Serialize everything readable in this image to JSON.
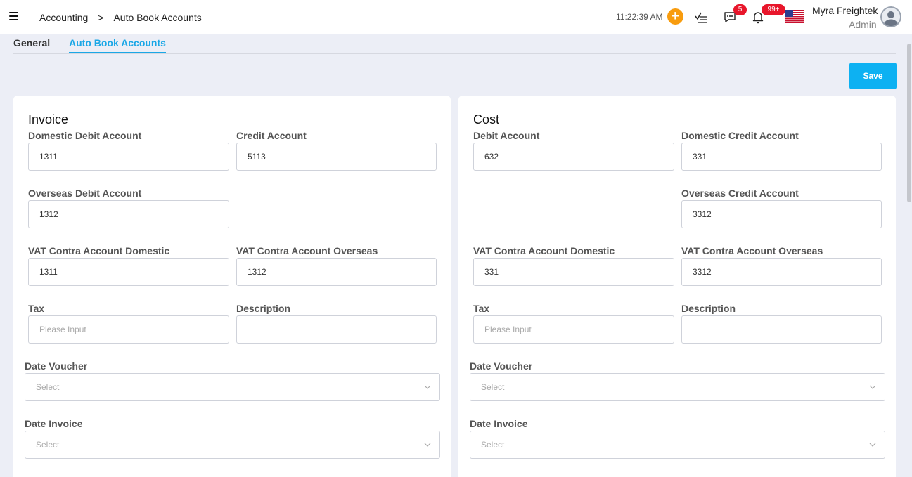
{
  "header": {
    "breadcrumb": [
      "Accounting",
      ">",
      "Auto Book Accounts"
    ],
    "clock": "11:22:39 AM",
    "add_label": "+",
    "chat_badge": "5",
    "bell_badge": "99+",
    "user_name": "Myra Freightek",
    "user_role": "Admin",
    "icons": [
      "menu-icon",
      "plus-icon",
      "checklist-icon",
      "chat-icon",
      "bell-icon",
      "us-flag-icon",
      "avatar"
    ]
  },
  "tabs": [
    {
      "label": "General",
      "active": false
    },
    {
      "label": "Auto Book Accounts",
      "active": true
    }
  ],
  "save_label": "Save",
  "invoice": {
    "title": "Invoice",
    "domestic_debit": {
      "label": "Domestic Debit Account",
      "value": "1311"
    },
    "credit": {
      "label": "Credit Account",
      "value": "5113"
    },
    "overseas_debit": {
      "label": "Overseas Debit Account",
      "value": "1312"
    },
    "vat_domestic": {
      "label": "VAT Contra Account Domestic",
      "value": "1311"
    },
    "vat_overseas": {
      "label": "VAT Contra Account Overseas",
      "value": "1312"
    },
    "tax": {
      "label": "Tax",
      "placeholder": "Please Input"
    },
    "description": {
      "label": "Description",
      "value": ""
    },
    "date_voucher": {
      "label": "Date Voucher",
      "placeholder": "Select"
    },
    "date_invoice": {
      "label": "Date Invoice",
      "placeholder": "Select"
    }
  },
  "cost": {
    "title": "Cost",
    "debit": {
      "label": "Debit Account",
      "value": "632"
    },
    "domestic_credit": {
      "label": "Domestic Credit Account",
      "value": "331"
    },
    "overseas_credit": {
      "label": "Overseas Credit Account",
      "value": "3312"
    },
    "vat_domestic": {
      "label": "VAT Contra Account Domestic",
      "value": "331"
    },
    "vat_overseas": {
      "label": "VAT Contra Account Overseas",
      "value": "3312"
    },
    "tax": {
      "label": "Tax",
      "placeholder": "Please Input"
    },
    "description": {
      "label": "Description",
      "value": ""
    },
    "date_voucher": {
      "label": "Date Voucher",
      "placeholder": "Select"
    },
    "date_invoice": {
      "label": "Date Invoice",
      "placeholder": "Select"
    }
  },
  "colors": {
    "accent": "#1aa7e6",
    "save": "#0db1f2",
    "add": "#f89c0e",
    "badge": "#e8162b"
  }
}
